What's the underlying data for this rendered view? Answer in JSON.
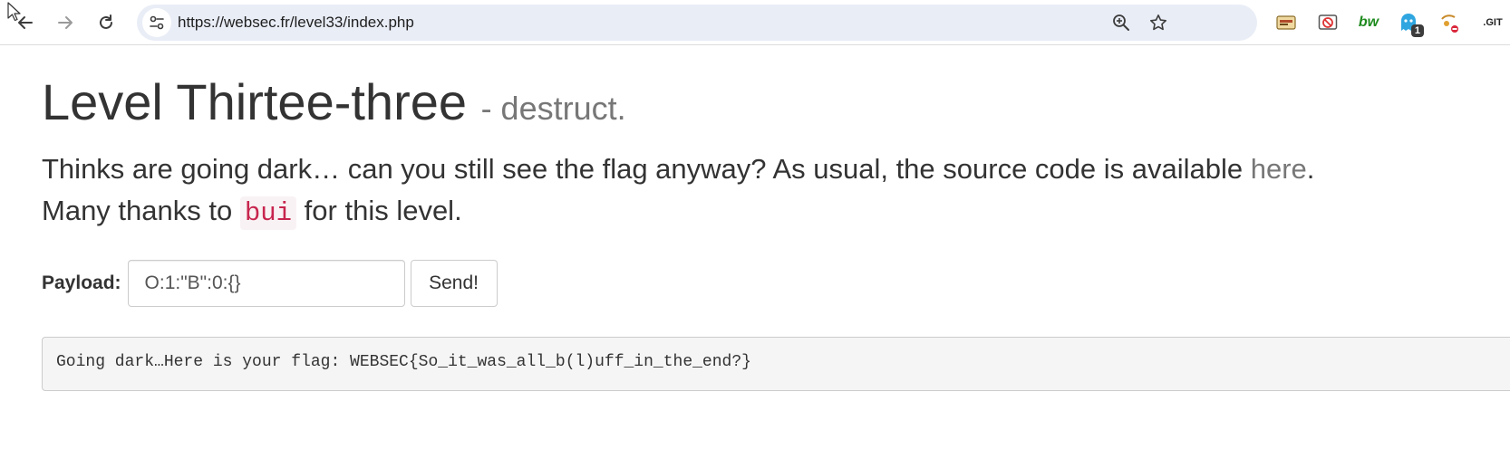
{
  "browser": {
    "url": "https://websec.fr/level33/index.php",
    "nav": {
      "back_icon": "arrow-left-icon",
      "forward_icon": "arrow-right-icon",
      "reload_icon": "reload-icon"
    },
    "omnibox_icons": [
      "site-info-icon",
      "zoom-icon",
      "bookmark-star-icon"
    ],
    "extensions": [
      {
        "name": "extension-1-icon"
      },
      {
        "name": "extension-blocker-icon"
      },
      {
        "name": "extension-bw-icon",
        "label": "bw"
      },
      {
        "name": "extension-tracker-icon",
        "badge": "1"
      },
      {
        "name": "extension-puzzle-icon"
      },
      {
        "name": "extension-git-icon",
        "label": ".GIT"
      }
    ]
  },
  "page": {
    "title": "Level Thirtee-three",
    "subtitle": "- destruct.",
    "lead_line1_prefix": "Thinks are going dark… can you still see the flag anyway? As usual, the source code is available ",
    "lead_link": "here",
    "lead_line1_suffix": ".",
    "lead_line2_prefix": "Many thanks to ",
    "lead_code": "bui",
    "lead_line2_suffix": " for this level."
  },
  "form": {
    "label": "Payload:",
    "input_value": "O:1:\"B\":0:{}",
    "button_label": "Send!"
  },
  "output": {
    "text": "Going dark…Here is your flag: WEBSEC{So_it_was_all_b(l)uff_in_the_end?}"
  },
  "colors": {
    "link": "#777777",
    "code": "#c7254e",
    "omnibox_bg": "#e9edf6"
  }
}
